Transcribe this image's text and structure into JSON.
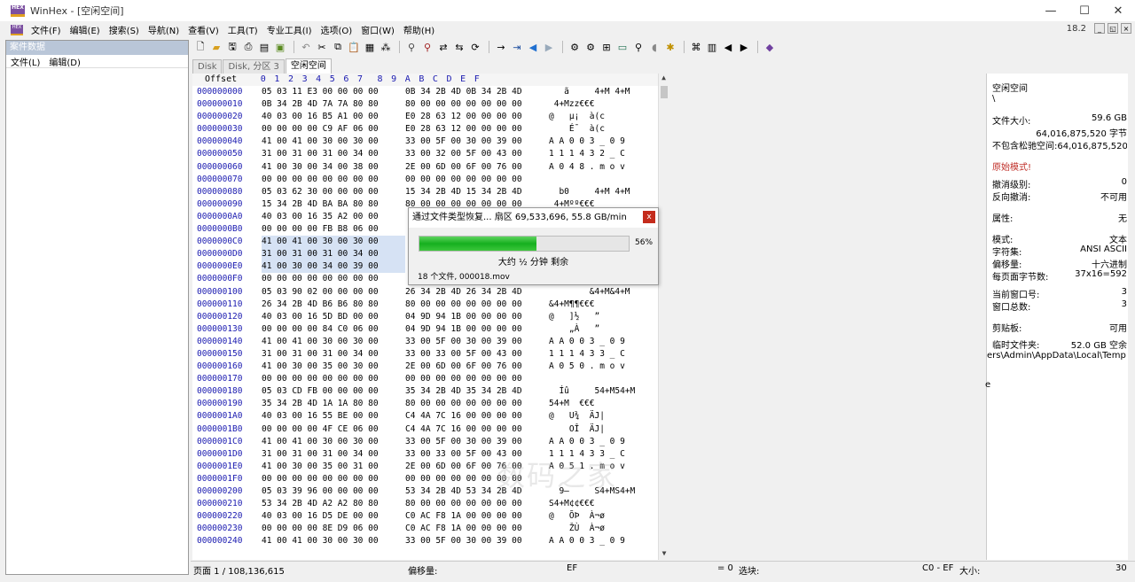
{
  "window": {
    "title": "WinHex - [空闲空间]",
    "minimize": "—",
    "maximize": "☐",
    "close": "✕"
  },
  "menu": {
    "items": [
      "文件(F)",
      "编辑(E)",
      "搜索(S)",
      "导航(N)",
      "查看(V)",
      "工具(T)",
      "专业工具(I)",
      "选项(O)",
      "窗口(W)",
      "帮助(H)"
    ],
    "version": "18.2",
    "mdi": [
      "_",
      "◱",
      "×"
    ]
  },
  "sidebar": {
    "title": "案件数据",
    "menu": [
      "文件(L)",
      "编辑(D)"
    ]
  },
  "tabs": [
    "Disk",
    "Disk, 分区 3",
    "空闲空间"
  ],
  "hex": {
    "header_offset": "Offset",
    "header_cols": [
      "0",
      "1",
      "2",
      "3",
      "4",
      "5",
      "6",
      "7",
      "8",
      "9",
      "A",
      "B",
      "C",
      "D",
      "E",
      "F"
    ],
    "rows": [
      {
        "off": "000000000",
        "a": "05 03 11 E3 00 00 00 00",
        "b": "0B 34 2B 4D 0B 34 2B 4D",
        "asc": "   ã     4+M 4+M"
      },
      {
        "off": "000000010",
        "a": "0B 34 2B 4D 7A 7A 80 80",
        "b": "80 00 00 00 00 00 00 00",
        "asc": " 4+Mzz€€€"
      },
      {
        "off": "000000020",
        "a": "40 03 00 16 B5 A1 00 00",
        "b": "E0 28 63 12 00 00 00 00",
        "asc": "@   µ¡  à(c"
      },
      {
        "off": "000000030",
        "a": "00 00 00 00 C9 AF 06 00",
        "b": "E0 28 63 12 00 00 00 00",
        "asc": "    É¯  à(c"
      },
      {
        "off": "000000040",
        "a": "41 00 41 00 30 00 30 00",
        "b": "33 00 5F 00 30 00 39 00",
        "asc": "A A 0 0 3 _ 0 9"
      },
      {
        "off": "000000050",
        "a": "31 00 31 00 31 00 34 00",
        "b": "33 00 32 00 5F 00 43 00",
        "asc": "1 1 1 4 3 2 _ C"
      },
      {
        "off": "000000060",
        "a": "41 00 30 00 34 00 38 00",
        "b": "2E 00 6D 00 6F 00 76 00",
        "asc": "A 0 4 8 . m o v"
      },
      {
        "off": "000000070",
        "a": "00 00 00 00 00 00 00 00",
        "b": "00 00 00 00 00 00 00 00",
        "asc": ""
      },
      {
        "off": "000000080",
        "a": "05 03 62 30 00 00 00 00",
        "b": "15 34 2B 4D 15 34 2B 4D",
        "asc": "  b0     4+M 4+M"
      },
      {
        "off": "000000090",
        "a": "15 34 2B 4D BA BA 80 80",
        "b": "80 00 00 00 00 00 00 00",
        "asc": " 4+Mºº€€€"
      },
      {
        "off": "0000000A0",
        "a": "40 03 00 16 35 A2 00 00",
        "b": "",
        "asc": ""
      },
      {
        "off": "0000000B0",
        "a": "00 00 00 00 FB B8 06 00",
        "b": "",
        "asc": ""
      },
      {
        "off": "0000000C0",
        "a": "41 00 41 00 30 00 30 00",
        "b": "",
        "asc": ""
      },
      {
        "off": "0000000D0",
        "a": "31 00 31 00 31 00 34 00",
        "b": "",
        "asc": ""
      },
      {
        "off": "0000000E0",
        "a": "41 00 30 00 34 00 39 00",
        "b": "",
        "asc": ""
      },
      {
        "off": "0000000F0",
        "a": "00 00 00 00 00 00 00 00",
        "b": "",
        "asc": ""
      },
      {
        "off": "000000100",
        "a": "05 03 90 02 00 00 00 00",
        "b": "26 34 2B 4D 26 34 2B 4D",
        "asc": "        &4+M&4+M"
      },
      {
        "off": "000000110",
        "a": "26 34 2B 4D B6 B6 80 80",
        "b": "80 00 00 00 00 00 00 00",
        "asc": "&4+M¶¶€€€"
      },
      {
        "off": "000000120",
        "a": "40 03 00 16 5D BD 00 00",
        "b": "04 9D 94 1B 00 00 00 00",
        "asc": "@   ]½   ”"
      },
      {
        "off": "000000130",
        "a": "00 00 00 00 84 C0 06 00",
        "b": "04 9D 94 1B 00 00 00 00",
        "asc": "    „À   ”"
      },
      {
        "off": "000000140",
        "a": "41 00 41 00 30 00 30 00",
        "b": "33 00 5F 00 30 00 39 00",
        "asc": "A A 0 0 3 _ 0 9"
      },
      {
        "off": "000000150",
        "a": "31 00 31 00 31 00 34 00",
        "b": "33 00 33 00 5F 00 43 00",
        "asc": "1 1 1 4 3 3 _ C"
      },
      {
        "off": "000000160",
        "a": "41 00 30 00 35 00 30 00",
        "b": "2E 00 6D 00 6F 00 76 00",
        "asc": "A 0 5 0 . m o v"
      },
      {
        "off": "000000170",
        "a": "00 00 00 00 00 00 00 00",
        "b": "00 00 00 00 00 00 00 00",
        "asc": ""
      },
      {
        "off": "000000180",
        "a": "05 03 CD FB 00 00 00 00",
        "b": "35 34 2B 4D 35 34 2B 4D",
        "asc": "  Íû     54+M54+M"
      },
      {
        "off": "000000190",
        "a": "35 34 2B 4D 1A 1A 80 80",
        "b": "80 00 00 00 00 00 00 00",
        "asc": "54+M  €€€"
      },
      {
        "off": "0000001A0",
        "a": "40 03 00 16 55 BE 00 00",
        "b": "C4 4A 7C 16 00 00 00 00",
        "asc": "@   U¾  ÄJ|"
      },
      {
        "off": "0000001B0",
        "a": "00 00 00 00 4F CE 06 00",
        "b": "C4 4A 7C 16 00 00 00 00",
        "asc": "    OÎ  ÄJ|"
      },
      {
        "off": "0000001C0",
        "a": "41 00 41 00 30 00 30 00",
        "b": "33 00 5F 00 30 00 39 00",
        "asc": "A A 0 0 3 _ 0 9"
      },
      {
        "off": "0000001D0",
        "a": "31 00 31 00 31 00 34 00",
        "b": "33 00 33 00 5F 00 43 00",
        "asc": "1 1 1 4 3 3 _ C"
      },
      {
        "off": "0000001E0",
        "a": "41 00 30 00 35 00 31 00",
        "b": "2E 00 6D 00 6F 00 76 00",
        "asc": "A 0 5 1 . m o v"
      },
      {
        "off": "0000001F0",
        "a": "00 00 00 00 00 00 00 00",
        "b": "00 00 00 00 00 00 00 00",
        "asc": ""
      },
      {
        "off": "000000200",
        "a": "05 03 39 96 00 00 00 00",
        "b": "53 34 2B 4D 53 34 2B 4D",
        "asc": "  9–     S4+MS4+M"
      },
      {
        "off": "000000210",
        "a": "53 34 2B 4D A2 A2 80 80",
        "b": "80 00 00 00 00 00 00 00",
        "asc": "S4+M¢¢€€€"
      },
      {
        "off": "000000220",
        "a": "40 03 00 16 D5 DE 00 00",
        "b": "C0 AC F8 1A 00 00 00 00",
        "asc": "@   ÕÞ  À¬ø"
      },
      {
        "off": "000000230",
        "a": "00 00 00 00 8E D9 06 00",
        "b": "C0 AC F8 1A 00 00 00 00",
        "asc": "    ŽÙ  À¬ø"
      },
      {
        "off": "000000240",
        "a": "41 00 41 00 30 00 30 00",
        "b": "33 00 5F 00 30 00 39 00",
        "asc": "A A 0 0 3 _ 0 9"
      }
    ]
  },
  "info": {
    "name": "空闲空间",
    "path": "\\",
    "file_size_label": "文件大小:",
    "file_size_gb": "59.6 GB",
    "file_size_bytes": "64,016,875,520 字节",
    "no_slack_label": "不包含松驰空间:",
    "no_slack_val": "64,016,875,520 字节",
    "mode_raw": "原始模式!",
    "undo_level_label": "撤消级别:",
    "undo_level_val": "0",
    "redo_label": "反向撤消:",
    "redo_val": "不可用",
    "attr_label": "属性:",
    "attr_val": "无",
    "mode_label": "模式:",
    "mode_val": "文本",
    "charset_label": "字符集:",
    "charset_val": "ANSI ASCII",
    "offset_label": "偏移量:",
    "offset_val": "十六进制",
    "bpp_label": "每页面字节数:",
    "bpp_val": "37x16=592",
    "curwin_label": "当前窗口号:",
    "curwin_val": "3",
    "totalwin_label": "窗口总数:",
    "totalwin_val": "3",
    "clipboard_label": "剪贴板:",
    "clipboard_val": "可用",
    "tempfolder_label": "临时文件夹:",
    "tempfolder_val": "52.0 GB 空余",
    "tempfolder_path": "ers\\Admin\\AppData\\Local\\Temp",
    "stray": "e"
  },
  "status": {
    "page": "页面 1 / 108,136,615",
    "offset_label": "偏移量:",
    "offset_val": "EF",
    "eq": "= 0",
    "sel_label": "选块:",
    "sel_val": "C0 - EF",
    "size_label": "大小:",
    "size_val": "30"
  },
  "dialog": {
    "title": "通过文件类型恢复... 扇区 69,533,696, 55.8 GB/min",
    "close": "x",
    "progress": 0.56,
    "progress_text": "56%",
    "remaining": "大约 ½ 分钟 剩余",
    "files": "18 个文件, 000018.mov"
  },
  "watermark": "数码之家",
  "colors": {
    "accent": "#1a1ab0",
    "progress": "#15b01e",
    "selection": "#d6e2f4",
    "sidebar_title": "#b9c6d8"
  }
}
